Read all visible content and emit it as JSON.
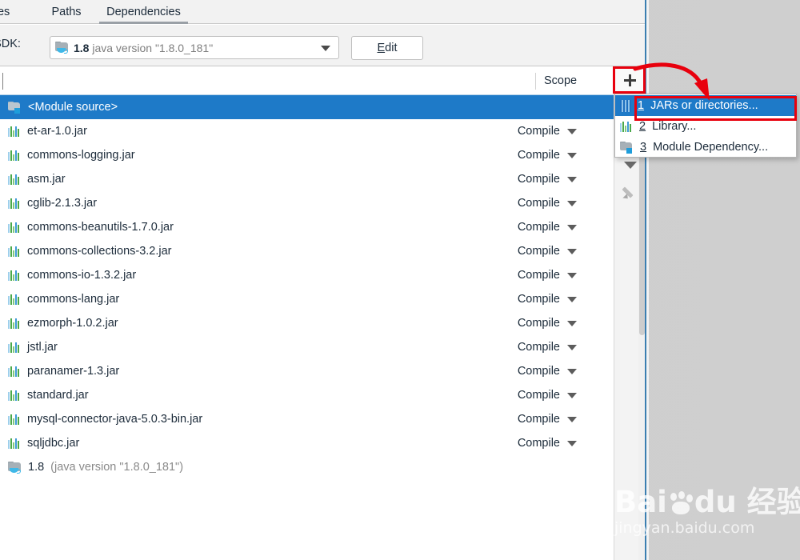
{
  "tabs": [
    {
      "label": "ces",
      "selected": false
    },
    {
      "label": "Paths",
      "selected": false
    },
    {
      "label": "Dependencies",
      "selected": true
    }
  ],
  "sdk": {
    "label": "e SDK:",
    "icon": "jdk-folder-icon",
    "version": "1.8",
    "description": "java version \"1.8.0_181\"",
    "caret": "chevron-down-icon",
    "edit_button": {
      "prefix": "E",
      "rest": "dit"
    }
  },
  "table": {
    "header": {
      "export": "t",
      "scope": "Scope"
    },
    "scope_default": "Compile",
    "rows": [
      {
        "name": "<Module source>",
        "icon": "module-folder-icon",
        "scope": "",
        "selected": true
      },
      {
        "name": "et-ar-1.0.jar",
        "icon": "jar-icon",
        "scope": "Compile",
        "selected": false
      },
      {
        "name": "commons-logging.jar",
        "icon": "jar-icon",
        "scope": "Compile",
        "selected": false
      },
      {
        "name": "asm.jar",
        "icon": "jar-icon",
        "scope": "Compile",
        "selected": false
      },
      {
        "name": "cglib-2.1.3.jar",
        "icon": "jar-icon",
        "scope": "Compile",
        "selected": false
      },
      {
        "name": "commons-beanutils-1.7.0.jar",
        "icon": "jar-icon",
        "scope": "Compile",
        "selected": false
      },
      {
        "name": "commons-collections-3.2.jar",
        "icon": "jar-icon",
        "scope": "Compile",
        "selected": false
      },
      {
        "name": "commons-io-1.3.2.jar",
        "icon": "jar-icon",
        "scope": "Compile",
        "selected": false
      },
      {
        "name": "commons-lang.jar",
        "icon": "jar-icon",
        "scope": "Compile",
        "selected": false
      },
      {
        "name": "ezmorph-1.0.2.jar",
        "icon": "jar-icon",
        "scope": "Compile",
        "selected": false
      },
      {
        "name": "jstl.jar",
        "icon": "jar-icon",
        "scope": "Compile",
        "selected": false
      },
      {
        "name": "paranamer-1.3.jar",
        "icon": "jar-icon",
        "scope": "Compile",
        "selected": false
      },
      {
        "name": "standard.jar",
        "icon": "jar-icon",
        "scope": "Compile",
        "selected": false
      },
      {
        "name": "mysql-connector-java-5.0.3-bin.jar",
        "icon": "jar-icon",
        "scope": "Compile",
        "selected": false
      },
      {
        "name": "sqljdbc.jar",
        "icon": "jar-icon",
        "scope": "Compile",
        "selected": false
      },
      {
        "name": "1.8",
        "name_dim": " (java version \"1.8.0_181\")",
        "icon": "jdk-folder-icon",
        "scope": "",
        "selected": false
      }
    ]
  },
  "toolbar": {
    "add": "+",
    "add_icon": "plus-icon",
    "move_down_icon": "triangle-down-icon",
    "edit_icon": "pencil-icon"
  },
  "menu": {
    "items": [
      {
        "num": "1",
        "label": "JARs or directories...",
        "icon": "jar-file-icon",
        "highlighted": true
      },
      {
        "num": "2",
        "label": "Library...",
        "icon": "library-icon",
        "highlighted": false
      },
      {
        "num": "3",
        "label": "Module Dependency...",
        "icon": "module-folder-icon",
        "highlighted": false
      }
    ]
  },
  "annotations": {
    "color": "#e8000d",
    "boxes": [
      "add-button",
      "menu-item-jars-or-directories"
    ],
    "arrow": "curved-arrow-from-add-to-menu-item"
  },
  "watermark": {
    "line1_a": "Bai",
    "line1_b": "du",
    "line1_c": "经验",
    "line2": "jingyan.baidu.com"
  }
}
